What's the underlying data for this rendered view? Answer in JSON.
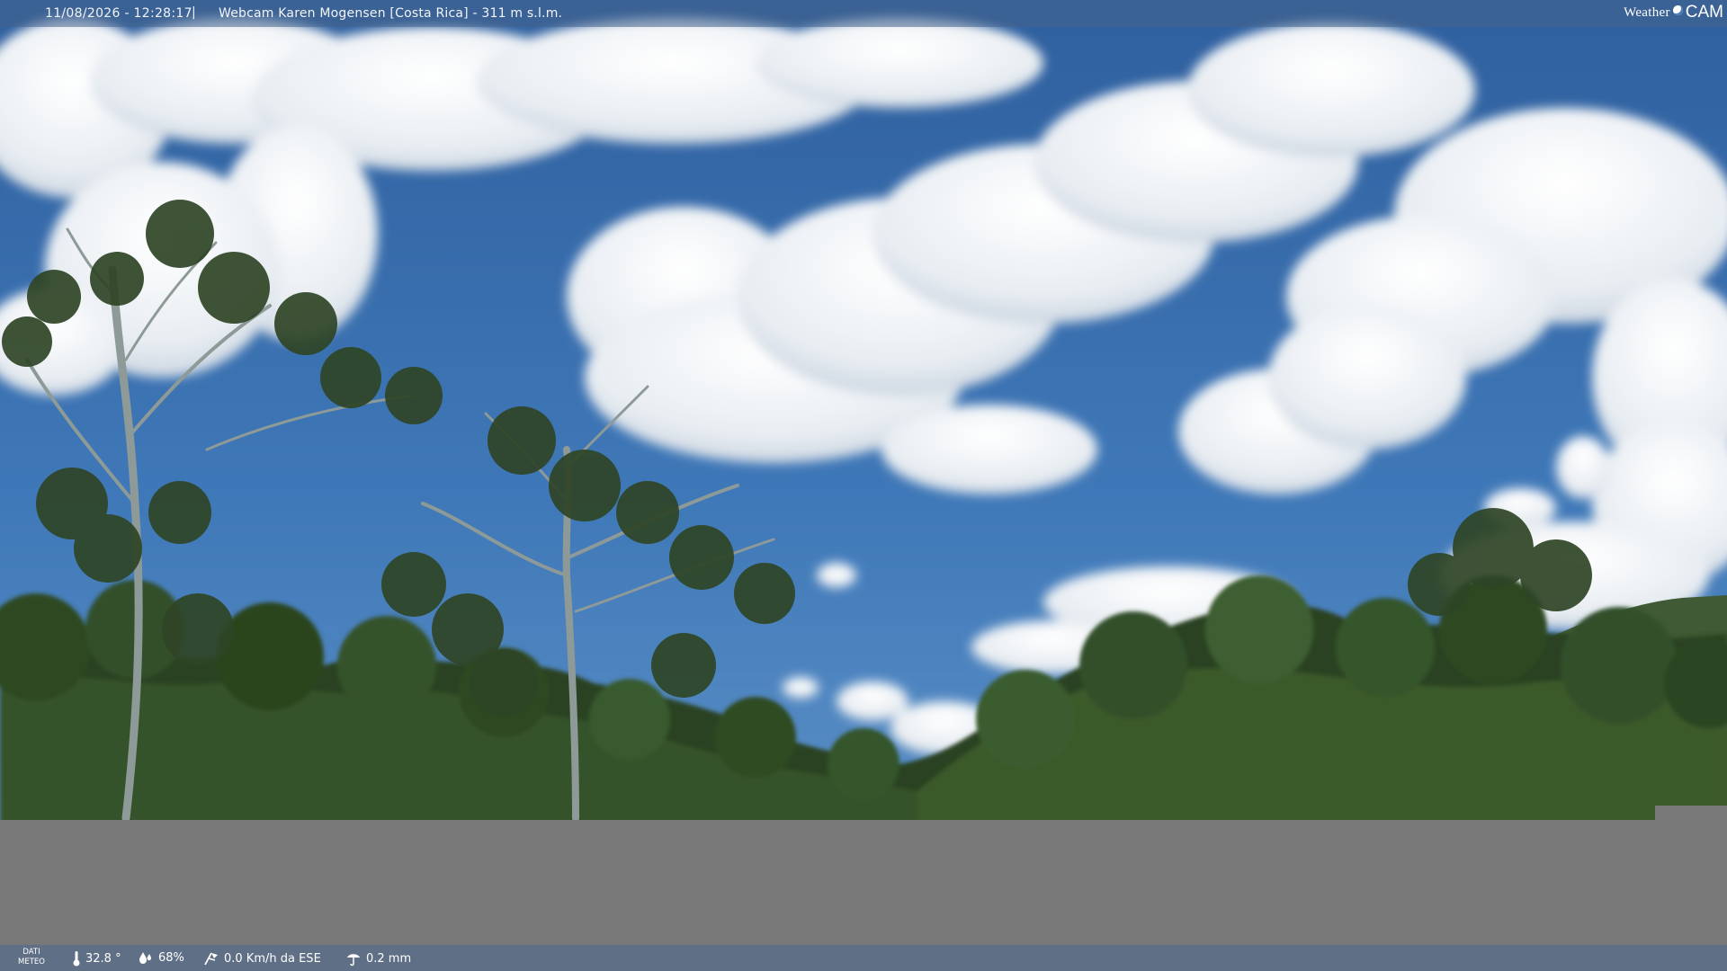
{
  "header": {
    "timestamp": "11/08/2026 - 12:28:17",
    "separator": "|",
    "title": "Webcam Karen Mogensen [Costa Rica]  - 311 m s.l.m."
  },
  "brand": {
    "word": "Weather",
    "cam": "CAM"
  },
  "weather": {
    "label_line1": "DATI",
    "label_line2": "METEO",
    "temperature": "32.8 °",
    "humidity": "68%",
    "wind": "0.0 Km/h da ESE",
    "rain": "0.2 mm",
    "icons": [
      "thermometer-icon",
      "humidity-icon",
      "wind-icon",
      "rain-icon"
    ]
  },
  "colors": {
    "sky_top": "#2f5f9e",
    "sky_bottom": "#4c86c4",
    "foliage": "#2f4a22",
    "overlay_grey": "#787878",
    "bottom_bar": "#5f6f86"
  }
}
